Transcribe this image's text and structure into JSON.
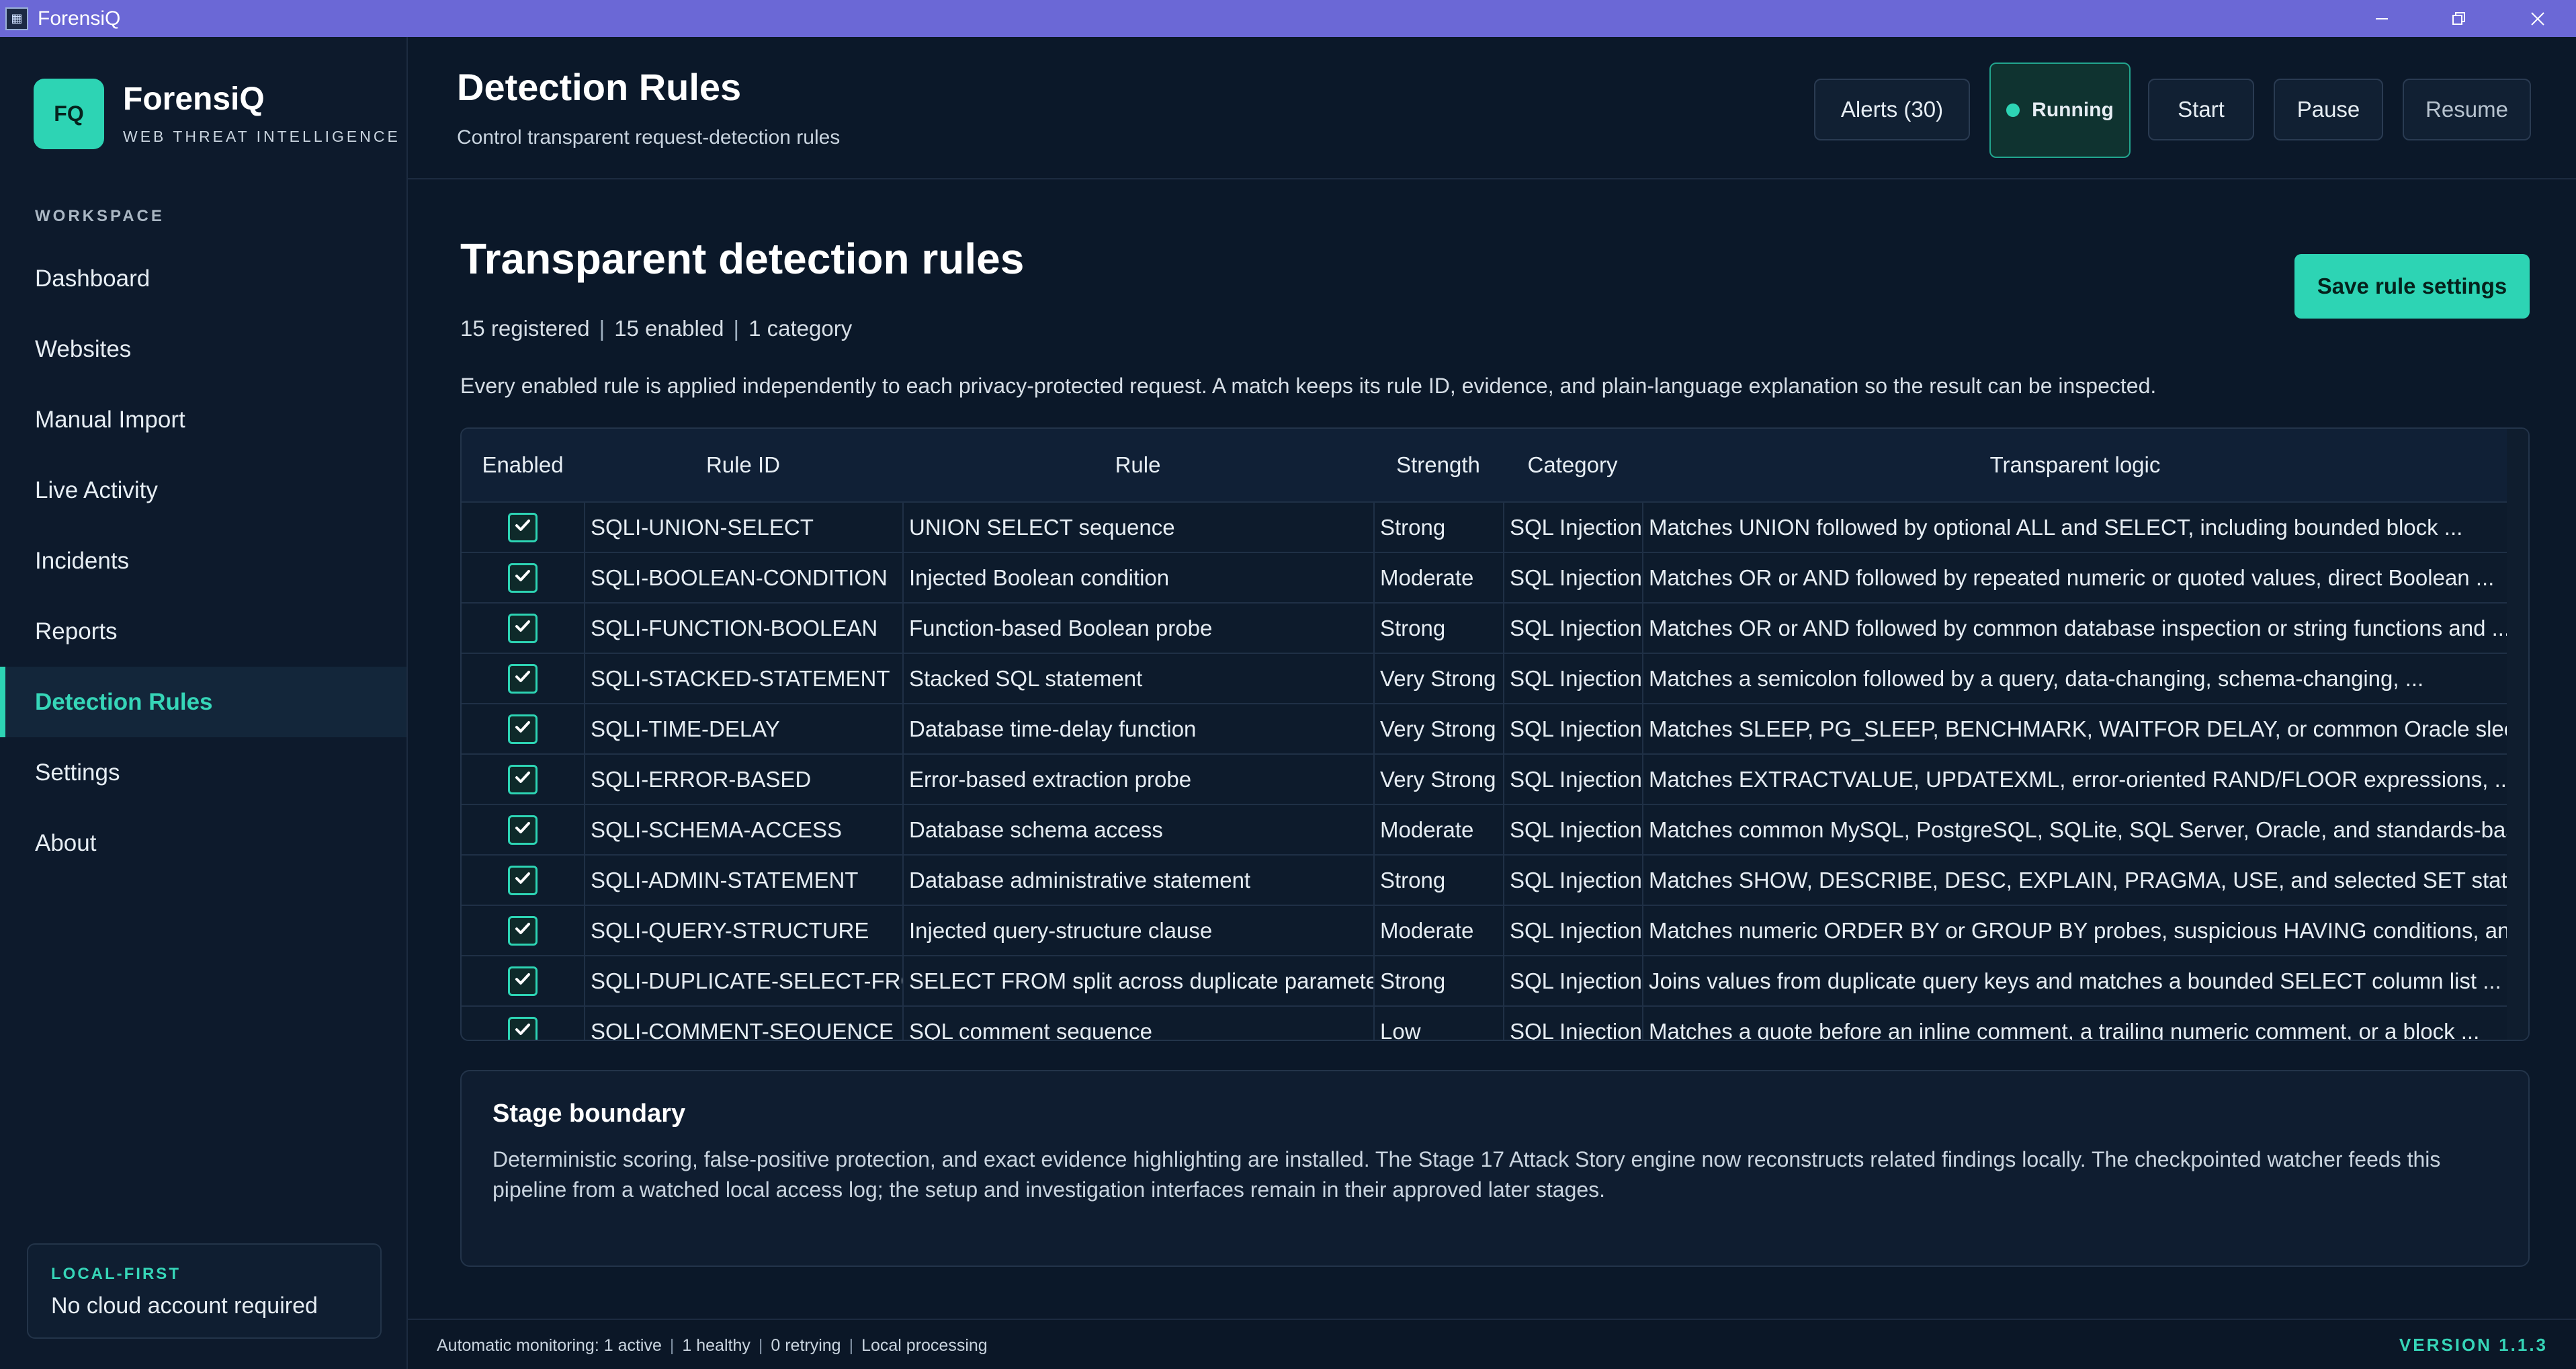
{
  "window": {
    "title": "ForensiQ",
    "icon": "app-shield-icon"
  },
  "brand": {
    "logo": "FQ",
    "name": "ForensiQ",
    "subtitle": "WEB THREAT INTELLIGENCE"
  },
  "sidebar": {
    "section": "WORKSPACE",
    "items": [
      {
        "label": "Dashboard"
      },
      {
        "label": "Websites"
      },
      {
        "label": "Manual Import"
      },
      {
        "label": "Live Activity"
      },
      {
        "label": "Incidents"
      },
      {
        "label": "Reports"
      },
      {
        "label": "Detection Rules",
        "active": true
      },
      {
        "label": "Settings"
      },
      {
        "label": "About"
      }
    ],
    "card": {
      "key": "LOCAL-FIRST",
      "value": "No cloud account required"
    }
  },
  "header": {
    "title": "Detection Rules",
    "subtitle": "Control transparent request-detection rules",
    "alerts": "Alerts (30)",
    "running": "Running",
    "start": "Start",
    "pause": "Pause",
    "resume": "Resume"
  },
  "main": {
    "title": "Transparent detection rules",
    "save": "Save rule settings",
    "summary": {
      "registered": "15 registered",
      "enabled": "15 enabled",
      "category": "1 category"
    },
    "description": "Every enabled rule is applied independently to each privacy-protected request. A match keeps its rule ID, evidence, and plain-language explanation so the result can be inspected."
  },
  "table": {
    "headers": [
      "Enabled",
      "Rule ID",
      "Rule",
      "Strength",
      "Category",
      "Transparent logic"
    ],
    "rows": [
      {
        "id": "SQLI-UNION-SELECT",
        "rule": "UNION SELECT sequence",
        "strength": "Strong",
        "category": "SQL Injection",
        "logic": "Matches UNION followed by optional ALL and SELECT, including bounded block ..."
      },
      {
        "id": "SQLI-BOOLEAN-CONDITION",
        "rule": "Injected Boolean condition",
        "strength": "Moderate",
        "category": "SQL Injection",
        "logic": "Matches OR or AND followed by repeated numeric or quoted values, direct Boolean ..."
      },
      {
        "id": "SQLI-FUNCTION-BOOLEAN",
        "rule": "Function-based Boolean probe",
        "strength": "Strong",
        "category": "SQL Injection",
        "logic": "Matches OR or AND followed by common database inspection or string functions and ..."
      },
      {
        "id": "SQLI-STACKED-STATEMENT",
        "rule": "Stacked SQL statement",
        "strength": "Very Strong",
        "category": "SQL Injection",
        "logic": "Matches a semicolon followed by a query, data-changing, schema-changing, ..."
      },
      {
        "id": "SQLI-TIME-DELAY",
        "rule": "Database time-delay function",
        "strength": "Very Strong",
        "category": "SQL Injection",
        "logic": "Matches SLEEP, PG_SLEEP, BENCHMARK, WAITFOR DELAY, or common Oracle sleep-..."
      },
      {
        "id": "SQLI-ERROR-BASED",
        "rule": "Error-based extraction probe",
        "strength": "Very Strong",
        "category": "SQL Injection",
        "logic": "Matches EXTRACTVALUE, UPDATEXML, error-oriented RAND/FLOOR expressions, ..."
      },
      {
        "id": "SQLI-SCHEMA-ACCESS",
        "rule": "Database schema access",
        "strength": "Moderate",
        "category": "SQL Injection",
        "logic": "Matches common MySQL, PostgreSQL, SQLite, SQL Server, Oracle, and standards-base..."
      },
      {
        "id": "SQLI-ADMIN-STATEMENT",
        "rule": "Database administrative statement",
        "strength": "Strong",
        "category": "SQL Injection",
        "logic": "Matches SHOW, DESCRIBE, DESC, EXPLAIN, PRAGMA, USE, and selected SET statement..."
      },
      {
        "id": "SQLI-QUERY-STRUCTURE",
        "rule": "Injected query-structure clause",
        "strength": "Moderate",
        "category": "SQL Injection",
        "logic": "Matches numeric ORDER BY or GROUP BY probes, suspicious HAVING conditions, and ..."
      },
      {
        "id": "SQLI-DUPLICATE-SELECT-FROM",
        "rule": "SELECT FROM split across duplicate parameters",
        "strength": "Strong",
        "category": "SQL Injection",
        "logic": "Joins values from duplicate query keys and matches a bounded SELECT column list ..."
      },
      {
        "id": "SQLI-COMMENT-SEQUENCE",
        "rule": "SQL comment sequence",
        "strength": "Low",
        "category": "SQL Injection",
        "logic": "Matches a quote before an inline comment, a trailing numeric comment, or a block ..."
      }
    ]
  },
  "stage": {
    "title": "Stage boundary",
    "text": "Deterministic scoring, false-positive protection, and exact evidence highlighting are installed. The Stage 17 Attack Story engine now reconstructs related findings locally. The checkpointed watcher feeds this pipeline from a watched local access log; the setup and investigation interfaces remain in their approved later stages."
  },
  "status": {
    "monitoring": "Automatic monitoring: 1 active",
    "healthy": "1 healthy",
    "retrying": "0 retrying",
    "processing": "Local processing",
    "version": "VERSION 1.1.3"
  }
}
